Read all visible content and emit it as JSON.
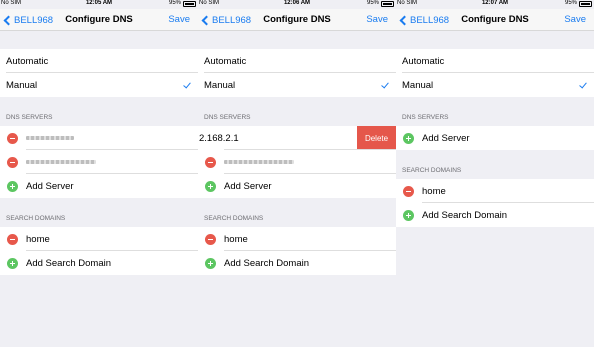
{
  "status_bar": [
    {
      "carrier": "No SIM",
      "time": "12:05 AM",
      "battery": "95%"
    },
    {
      "carrier": "No SIM",
      "time": "12:06 AM",
      "battery": "95%"
    },
    {
      "carrier": "No SIM",
      "time": "12:07 AM",
      "battery": "95%"
    }
  ],
  "nav": {
    "back_label": "BELL968",
    "title": "Configure DNS",
    "save_label": "Save"
  },
  "config": {
    "automatic": "Automatic",
    "manual": "Manual",
    "selected": "Manual"
  },
  "sections": {
    "dns_servers": "DNS SERVERS",
    "search_domains": "SEARCH DOMAINS"
  },
  "dns": {
    "add_server": "Add Server",
    "partial_ip": "2.168.2.1",
    "delete_label": "Delete"
  },
  "domains": {
    "home": "home",
    "add_search_domain": "Add Search Domain"
  },
  "colors": {
    "accent": "#1a7cf0",
    "delete": "#e5574b",
    "remove_icon": "#e7584b",
    "add_icon": "#5cc661"
  }
}
